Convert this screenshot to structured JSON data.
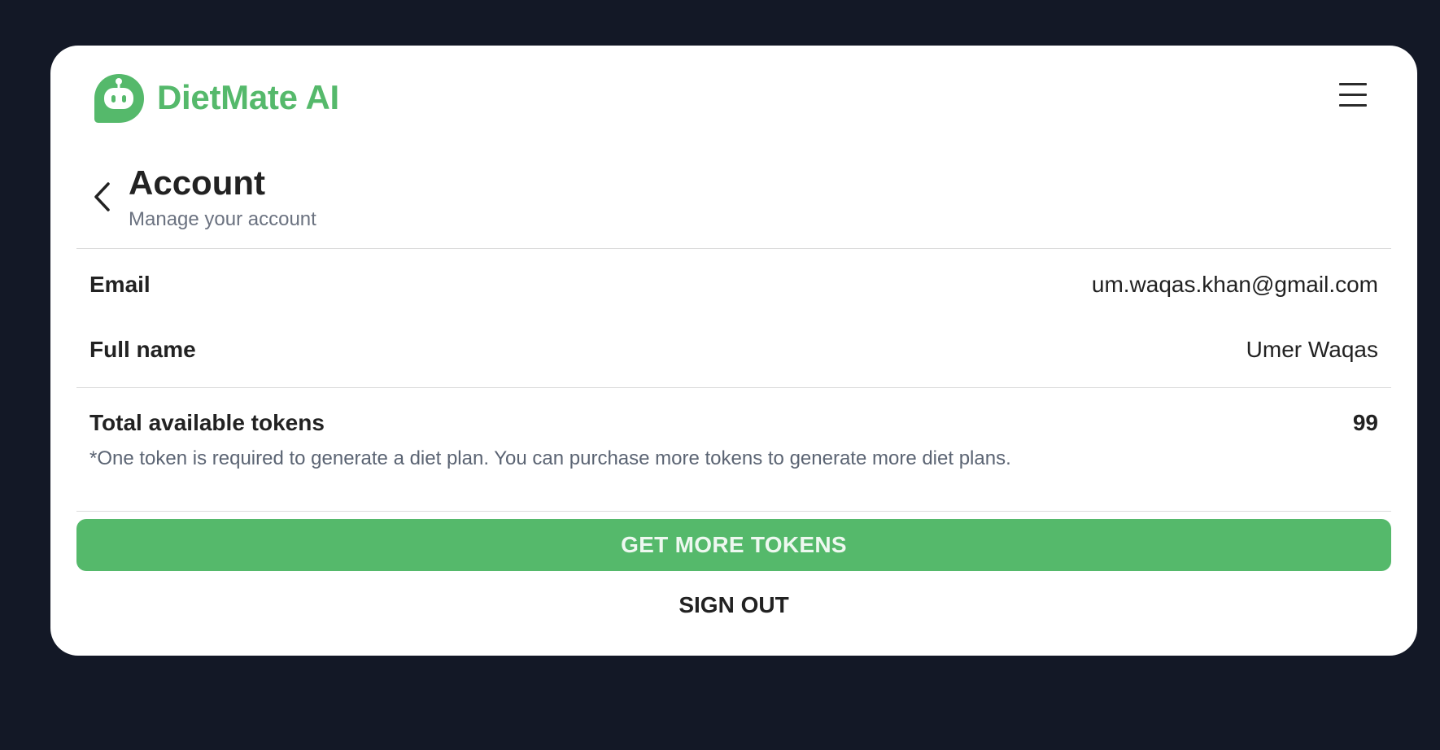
{
  "app": {
    "name": "DietMate AI",
    "brand_color": "#55b96b",
    "logo_icon": "robot-chat-bubble-icon"
  },
  "header": {
    "menu_icon": "hamburger-menu-icon"
  },
  "page": {
    "back_icon": "chevron-left-icon",
    "title": "Account",
    "subtitle": "Manage your account"
  },
  "account": {
    "email_label": "Email",
    "email_value": "um.waqas.khan@gmail.com",
    "fullname_label": "Full name",
    "fullname_value": "Umer Waqas"
  },
  "tokens": {
    "label": "Total available tokens",
    "value": "99",
    "note": "*One token is required to generate a diet plan. You can purchase more tokens to generate more diet plans."
  },
  "actions": {
    "get_more_tokens": "GET MORE TOKENS",
    "sign_out": "SIGN OUT"
  },
  "colors": {
    "background": "#131826",
    "card": "#ffffff",
    "accent": "#55b96b",
    "muted_text": "#6b7280"
  }
}
